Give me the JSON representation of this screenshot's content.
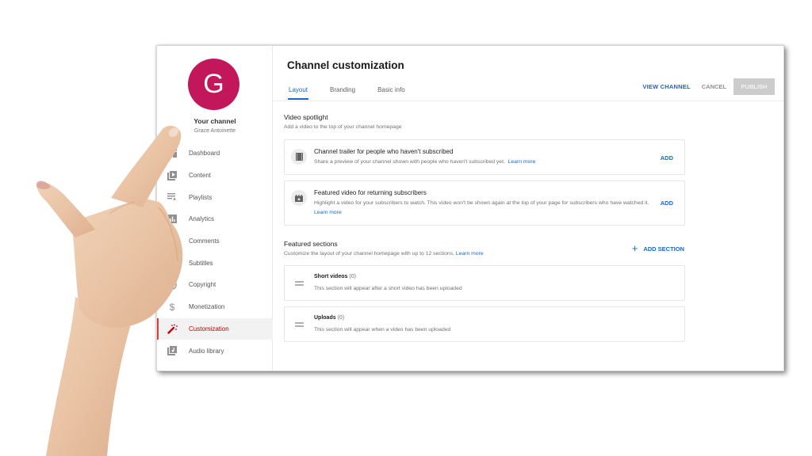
{
  "sidebar": {
    "avatar_letter": "G",
    "avatar_color": "#c2185b",
    "your_channel": "Your channel",
    "channel_name": "Grace Antoinette",
    "items": [
      {
        "label": "Dashboard",
        "icon": "dashboard-icon"
      },
      {
        "label": "Content",
        "icon": "content-icon"
      },
      {
        "label": "Playlists",
        "icon": "playlists-icon"
      },
      {
        "label": "Analytics",
        "icon": "analytics-icon"
      },
      {
        "label": "Comments",
        "icon": "comments-icon"
      },
      {
        "label": "Subtitles",
        "icon": "subtitles-icon"
      },
      {
        "label": "Copyright",
        "icon": "copyright-icon"
      },
      {
        "label": "Monetization",
        "icon": "monetization-icon"
      },
      {
        "label": "Customization",
        "icon": "customization-icon",
        "active": true
      },
      {
        "label": "Audio library",
        "icon": "audio-library-icon"
      }
    ]
  },
  "header": {
    "title": "Channel customization",
    "tabs": [
      {
        "label": "Layout",
        "active": true
      },
      {
        "label": "Branding"
      },
      {
        "label": "Basic info"
      }
    ],
    "view_channel": "VIEW CHANNEL",
    "cancel": "CANCEL",
    "publish": "PUBLISH"
  },
  "spotlight": {
    "title": "Video spotlight",
    "subtitle": "Add a video to the top of your channel homepage",
    "cards": [
      {
        "title": "Channel trailer for people who haven't subscribed",
        "desc": "Share a preview of your channel shown with people who haven't subscribed yet.",
        "learn_more": "Learn more",
        "action": "ADD"
      },
      {
        "title": "Featured video for returning subscribers",
        "desc": "Highlight a video for your subscribers to watch. This video won't be shown again at the top of your page for subscribers who have watched it.",
        "learn_more": "Learn more",
        "action": "ADD"
      }
    ]
  },
  "featured": {
    "title": "Featured sections",
    "subtitle": "Customize the layout of your channel homepage with up to 12 sections.",
    "learn_more": "Learn more",
    "add_section": "ADD SECTION",
    "sections": [
      {
        "title": "Short videos",
        "count": "(0)",
        "desc": "This section will appear after a short video has been uploaded"
      },
      {
        "title": "Uploads",
        "count": "(0)",
        "desc": "This section will appear when a video has been uploaded"
      }
    ]
  },
  "colors": {
    "accent": "#1967d2",
    "active_nav": "#cc0000",
    "publish_disabled": "#cccccc"
  }
}
